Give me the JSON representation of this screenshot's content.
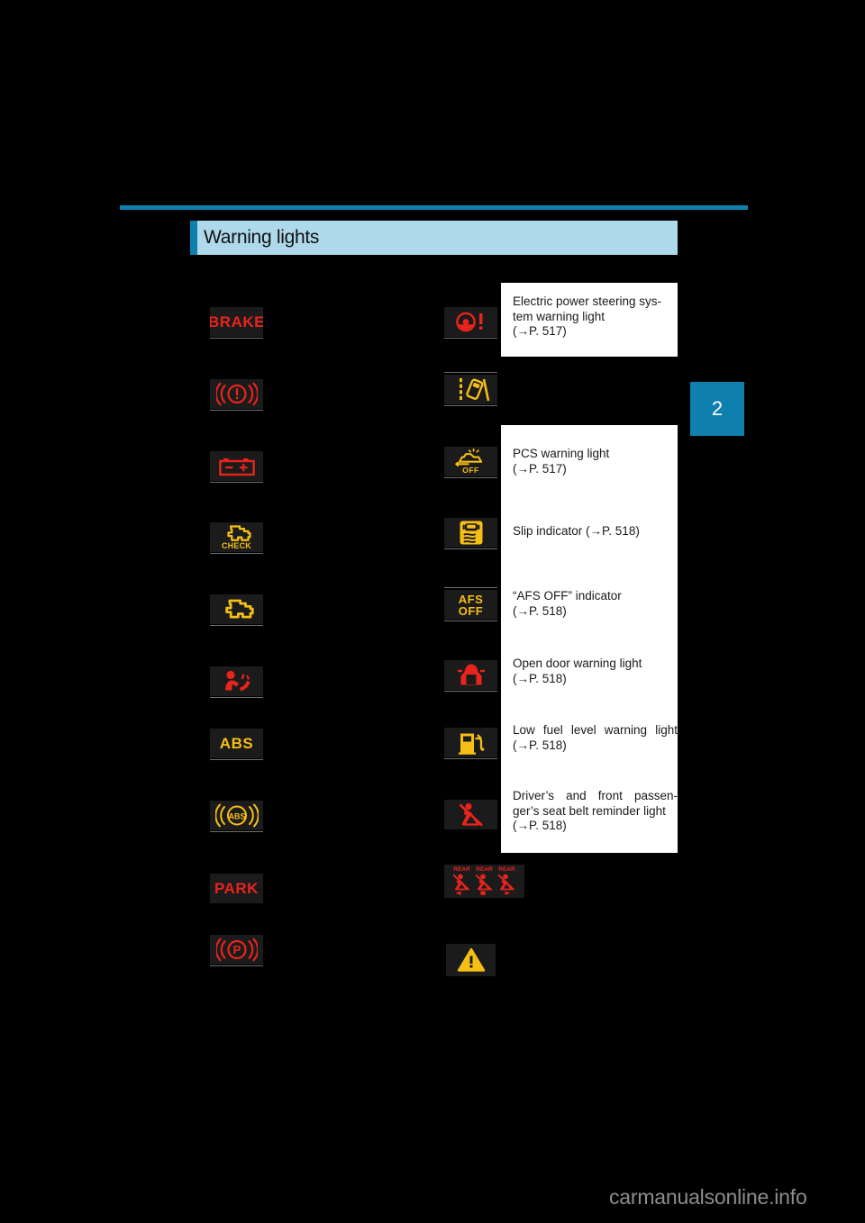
{
  "page": {
    "section_title": "Warning lights",
    "chapter_number": "2",
    "watermark": "carmanualsonline.info",
    "accent_color": "#0f7fad",
    "band_color": "#aed9ea",
    "icon_bg": "#1b1b1b",
    "red": "#e8241c",
    "amber": "#f5bf16"
  },
  "left_column": [
    {
      "id": "brake-system-warning",
      "icon": "brake-text-icon",
      "text": "BRAKE",
      "color": "#e8241c"
    },
    {
      "id": "brake-circle-warning",
      "icon": "brake-circle-exclamation-icon",
      "color": "#e8241c"
    },
    {
      "id": "charging-system-warning",
      "icon": "battery-icon",
      "color": "#e8241c"
    },
    {
      "id": "check-engine-warning",
      "icon": "engine-check-icon",
      "text": "CHECK",
      "color": "#f5bf16"
    },
    {
      "id": "malfunction-indicator",
      "icon": "engine-icon",
      "color": "#f5bf16"
    },
    {
      "id": "srs-airbag-warning",
      "icon": "airbag-occupant-icon",
      "color": "#e8241c"
    },
    {
      "id": "abs-warning",
      "icon": "abs-text-icon",
      "text": "ABS",
      "color": "#f5bf16"
    },
    {
      "id": "abs-brake-circle-warning",
      "icon": "abs-circle-icon",
      "text": "ABS",
      "color": "#f5bf16"
    },
    {
      "id": "park-warning",
      "icon": "park-text-icon",
      "text": "PARK",
      "color": "#e8241c"
    },
    {
      "id": "parking-brake-indicator",
      "icon": "parking-brake-p-icon",
      "color": "#e8241c"
    }
  ],
  "right_column": [
    {
      "id": "electric-power-steering-warning",
      "icon": "steering-wheel-exclamation-icon",
      "color": "#e8241c",
      "label_lines": [
        "Electric power steering sys-",
        "tem warning light",
        "(→P. 517)"
      ]
    },
    {
      "id": "lane-departure-alert",
      "icon": "lane-departure-icon",
      "color": "#f5bf16"
    },
    {
      "id": "pcs-warning",
      "icon": "pcs-off-icon",
      "text": "OFF",
      "color": "#f5bf16",
      "label_lines": [
        "PCS warning light",
        "(→P. 517)"
      ]
    },
    {
      "id": "slip-indicator",
      "icon": "vehicle-skid-icon",
      "color": "#f5bf16",
      "label_lines": [
        "Slip indicator (→P. 518)"
      ]
    },
    {
      "id": "afs-off-indicator",
      "icon": "afs-off-text-icon",
      "text": "AFS OFF",
      "color": "#f5bf16",
      "label_lines": [
        "“AFS OFF” indicator",
        "(→P. 518)"
      ]
    },
    {
      "id": "open-door-warning",
      "icon": "open-door-car-icon",
      "color": "#e8241c",
      "label_lines": [
        "Open door warning light",
        "(→P. 518)"
      ]
    },
    {
      "id": "low-fuel-warning",
      "icon": "fuel-pump-icon",
      "color": "#f5bf16",
      "label_lines": [
        "Low fuel level warning light",
        "(→P. 518)"
      ]
    },
    {
      "id": "front-seat-belt-reminder",
      "icon": "seat-belt-reminder-icon",
      "color": "#e8241c",
      "label_lines": [
        "Driver’s and front passen-",
        "ger’s seat belt reminder light",
        "(→P. 518)"
      ]
    },
    {
      "id": "rear-seat-belt-reminder",
      "icon": "rear-seat-belt-reminder-icon",
      "color": "#e8241c",
      "sub_labels": [
        "REAR",
        "REAR",
        "REAR"
      ]
    },
    {
      "id": "master-warning",
      "icon": "warning-triangle-icon",
      "color": "#f5bf16"
    }
  ],
  "callouts": {
    "eps": {
      "l1": "Electric power steering sys-",
      "l2": "tem warning light",
      "l3": "(→P. 517)"
    },
    "pcs": {
      "l1": "PCS warning light",
      "l2": "(→P. 517)"
    },
    "slip": {
      "l1": "Slip indicator (→P. 518)"
    },
    "afs": {
      "l1": "“AFS OFF” indicator",
      "l2": "(→P. 518)"
    },
    "door": {
      "l1": "Open door warning light",
      "l2": "(→P. 518)"
    },
    "fuel": {
      "l1": "Low fuel level warning light",
      "l2": "(→P. 518)"
    },
    "belt": {
      "l1": "Driver’s and front passen-",
      "l2": "ger’s seat belt reminder light",
      "l3": "(→P. 518)"
    }
  },
  "rear_labels": {
    "a": "REAR",
    "b": "REAR",
    "c": "REAR"
  }
}
